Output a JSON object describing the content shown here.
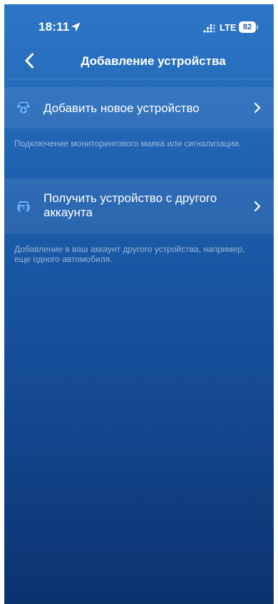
{
  "status_bar": {
    "time": "18:11",
    "network": "LTE",
    "battery": "82"
  },
  "nav": {
    "title": "Добавление устройства"
  },
  "items": [
    {
      "label": "Добавить новое устройство",
      "hint": "Подключение мониторингового маяка или сигнализации."
    },
    {
      "label": "Получить устройство с другого аккаунта",
      "hint": "Добавление в ваш аккаунт другого устройства, например, еще одного автомобиля."
    }
  ],
  "colors": {
    "background_top": "#2d77c6",
    "background_bottom": "#0c326e",
    "icon_tint": "#6fb6ff"
  },
  "icons": {
    "back": "chevron-left-icon",
    "add_device": "car-add-icon",
    "transfer_device": "car-transfer-icon",
    "row_arrow": "chevron-right-icon"
  }
}
